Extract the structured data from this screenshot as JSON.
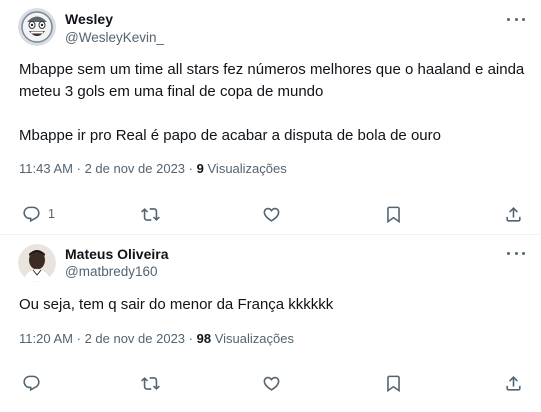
{
  "tweets": [
    {
      "author": {
        "name": "Wesley",
        "handle": "@WesleyKevin_"
      },
      "text": "Mbappe sem um time all stars fez números melhores que o haaland e ainda meteu 3 gols em uma final de copa de mundo\n\nMbappe ir pro Real é papo de acabar a disputa de bola de ouro",
      "time": "11:43 AM",
      "sep": "·",
      "date": "2 de nov de 2023",
      "views_count": "9",
      "views_label": "Visualizações",
      "reply_count": "1",
      "icons": [
        "reply-icon",
        "retweet-icon",
        "like-icon",
        "bookmark-icon",
        "share-icon"
      ]
    },
    {
      "author": {
        "name": "Mateus Oliveira",
        "handle": "@matbredy160"
      },
      "text": "Ou seja, tem q sair do menor da França kkkkkk",
      "time": "11:20 AM",
      "sep": "·",
      "date": "2 de nov de 2023",
      "views_count": "98",
      "views_label": "Visualizações",
      "reply_count": "",
      "icons": [
        "reply-icon",
        "retweet-icon",
        "like-icon",
        "bookmark-icon",
        "share-icon"
      ]
    }
  ],
  "colors": {
    "text": "#0f1419",
    "secondary": "#536471",
    "divider": "#eff3f4"
  }
}
